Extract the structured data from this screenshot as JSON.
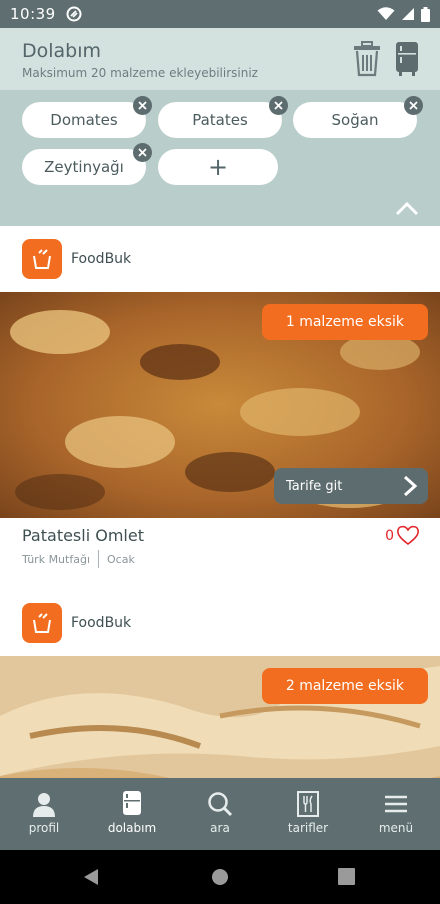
{
  "status_bar": {
    "time": "10:39"
  },
  "header": {
    "title": "Dolabım",
    "subtitle": "Maksimum 20 malzeme ekleyebilirsiniz"
  },
  "ingredients": {
    "items": [
      {
        "label": "Domates"
      },
      {
        "label": "Patates"
      },
      {
        "label": "Soğan"
      },
      {
        "label": "Zeytinyağı"
      }
    ],
    "add_label": "+"
  },
  "feed": {
    "cards": [
      {
        "brand": "FoodBuk",
        "missing_badge": "1 malzeme eksik",
        "cta_label": "Tarife git",
        "title": "Patatesli Omlet",
        "cuisine": "Türk Mutfağı",
        "course": "Ocak",
        "likes": "0"
      },
      {
        "brand": "FoodBuk",
        "missing_badge": "2 malzeme eksik"
      }
    ]
  },
  "bottom_nav": {
    "items": [
      {
        "label": "profil",
        "icon": "person-icon"
      },
      {
        "label": "dolabım",
        "icon": "fridge-icon"
      },
      {
        "label": "ara",
        "icon": "search-icon"
      },
      {
        "label": "tarifler",
        "icon": "recipe-book-icon"
      },
      {
        "label": "menü",
        "icon": "menu-icon"
      }
    ],
    "active": "dolabım"
  },
  "colors": {
    "accent": "#f26d1f",
    "header_bg": "#d3e1df",
    "chips_bg": "#b9cdca",
    "nav_bg": "#5f6e70",
    "like": "#e2262c"
  }
}
